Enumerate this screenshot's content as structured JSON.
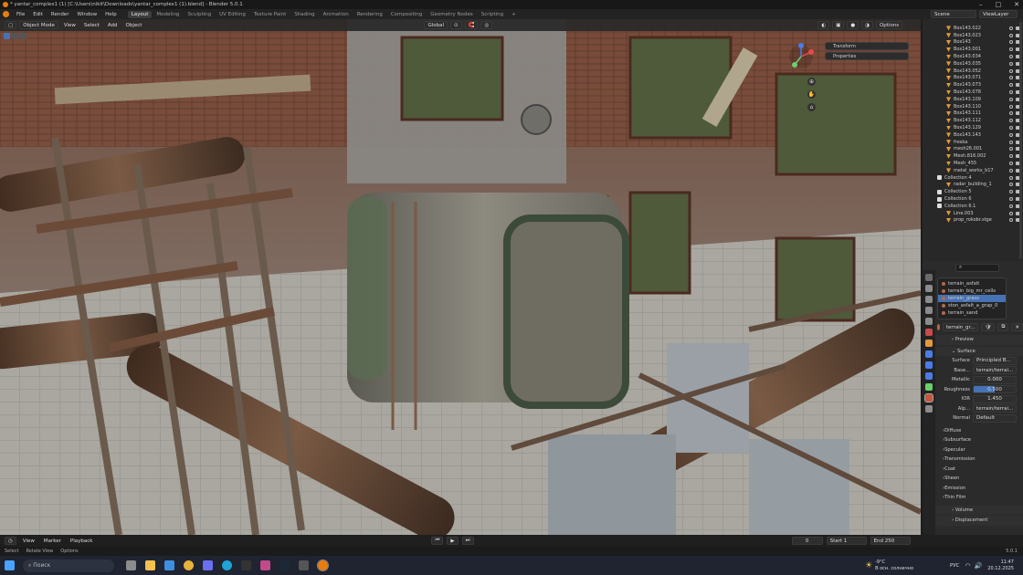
{
  "window": {
    "title": "* yantar_complex1 (1) [C:\\Users\\nikit\\Downloads\\yantar_complex1 (1).blend] - Blender 5.0.1"
  },
  "menu": {
    "items": [
      "File",
      "Edit",
      "Render",
      "Window",
      "Help"
    ]
  },
  "workspaces": [
    {
      "label": "Layout",
      "active": true
    },
    {
      "label": "Modeling"
    },
    {
      "label": "Sculpting"
    },
    {
      "label": "UV Editing"
    },
    {
      "label": "Texture Paint"
    },
    {
      "label": "Shading"
    },
    {
      "label": "Animation"
    },
    {
      "label": "Rendering"
    },
    {
      "label": "Compositing"
    },
    {
      "label": "Geometry Nodes"
    },
    {
      "label": "Scripting"
    }
  ],
  "topright": {
    "scene": "Scene",
    "view_layer": "ViewLayer"
  },
  "viewport_header": {
    "mode": "Object Mode",
    "view": "View",
    "select": "Select",
    "add": "Add",
    "object": "Object",
    "orientation": "Global",
    "options": "Options"
  },
  "npanel": {
    "transform": "Transform",
    "properties": "Properties"
  },
  "outliner": {
    "rows": [
      {
        "name": "Box143.022"
      },
      {
        "name": "Box143.023"
      },
      {
        "name": "Box143"
      },
      {
        "name": "Box143.001"
      },
      {
        "name": "Box143.034"
      },
      {
        "name": "Box143.035"
      },
      {
        "name": "Box143.052"
      },
      {
        "name": "Box143.071"
      },
      {
        "name": "Box143.073"
      },
      {
        "name": "Box143.078"
      },
      {
        "name": "Box143.109"
      },
      {
        "name": "Box143.110"
      },
      {
        "name": "Box143.111"
      },
      {
        "name": "Box143.112"
      },
      {
        "name": "Box143.129"
      },
      {
        "name": "Box143.143"
      },
      {
        "name": "freska"
      },
      {
        "name": "mesh26.001"
      },
      {
        "name": "Mesh.816.002"
      },
      {
        "name": "Mesh_455"
      },
      {
        "name": "metal_works_b17"
      },
      {
        "name": "Collection 4",
        "collection": true
      },
      {
        "name": "radar_building_1"
      },
      {
        "name": "Collection 5",
        "collection": true
      },
      {
        "name": "Collection 6",
        "collection": true
      },
      {
        "name": "Collection 6.1",
        "collection": true
      },
      {
        "name": "Line.003"
      },
      {
        "name": "prop_rokobr.stge"
      }
    ]
  },
  "properties": {
    "search_placeholder": "",
    "materials": [
      "terrain_asfalt",
      "terrain_big_mr_cells",
      "terrain_grass",
      "ston_asfalt_a_grap_0",
      "terrain_sand"
    ],
    "selected_material_index": 2,
    "active_material": "terrain_gr...",
    "sections": {
      "preview": "Preview",
      "surface": "Surface"
    },
    "surface_label": "Surface",
    "surface_value": "Principled B...",
    "base_color_label": "Base...",
    "base_color_value": "terrain/terrai...",
    "metallic_label": "Metallic",
    "metallic_value": "0.000",
    "roughness_label": "Roughness",
    "roughness_value": "0.500",
    "ior_label": "IOR",
    "ior_value": "1.450",
    "alpha_label": "Alp...",
    "alpha_value": "terrain/terrai...",
    "normal_label": "Normal",
    "normal_value": "Default",
    "subsections": [
      "Diffuse",
      "Subsurface",
      "Specular",
      "Transmission",
      "Coat",
      "Sheen",
      "Emission",
      "Thin Film"
    ],
    "displacement": "Volume",
    "settings": "Displacement"
  },
  "timeline": {
    "playback": "Playback",
    "view": "View",
    "marker": "Marker",
    "frame": "0",
    "start_label": "Start",
    "start": "1",
    "end_label": "End",
    "end": "250"
  },
  "status": {
    "select": "Select",
    "rotate": "Rotate View",
    "options": "Options",
    "version": "5.0.1"
  },
  "taskbar": {
    "search_placeholder": "Поиск",
    "weather_temp": "-9°C",
    "weather_text": "В осн. солнечно",
    "lang": "РУС",
    "time": "11:47",
    "date": "20.12.2025"
  }
}
